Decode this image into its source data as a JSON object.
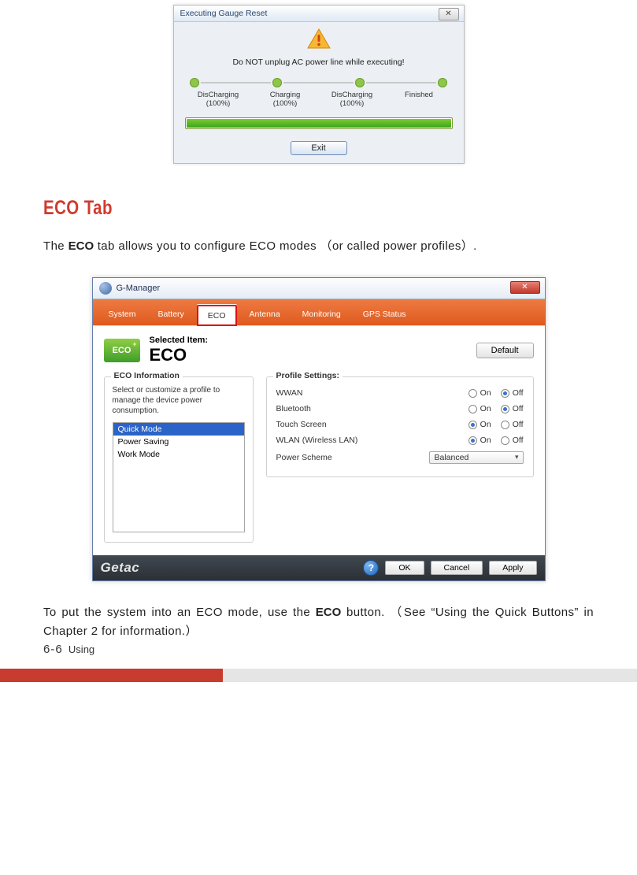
{
  "dlg1": {
    "title": "Executing Gauge Reset",
    "close_glyph": "✕",
    "warning_text": "Do NOT unplug AC power line while executing!",
    "steps": [
      "DisCharging\n(100%)",
      "Charging\n(100%)",
      "DisCharging\n(100%)",
      "Finished"
    ],
    "exit_label": "Exit"
  },
  "doc": {
    "heading": "ECO Tab",
    "para1_before": "The ",
    "para1_bold": "ECO",
    "para1_after": " tab allows you to configure ECO modes （or called power profiles）.",
    "para2_before": "To put the system into an ECO mode, use the ",
    "para2_bold": "ECO",
    "para2_after": " button. （See “Using the Quick Buttons” in Chapter 2 for information.）"
  },
  "dlg2": {
    "title": "G-Manager",
    "tabs": [
      "System",
      "Battery",
      "ECO",
      "Antenna",
      "Monitoring",
      "GPS Status"
    ],
    "active_tab_index": 2,
    "eco_badge": "ECO",
    "selected_item_label": "Selected Item:",
    "selected_item_value": "ECO",
    "default_btn": "Default",
    "eco_info": {
      "title": "ECO Information",
      "desc": "Select or customize a profile to manage the device power consumption.",
      "profiles": [
        "Quick Mode",
        "Power Saving",
        "Work Mode"
      ],
      "selected_index": 0
    },
    "profile_settings": {
      "title": "Profile Settings:",
      "rows": [
        {
          "name": "WWAN",
          "on": "On",
          "off": "Off",
          "checked": "off"
        },
        {
          "name": "Bluetooth",
          "on": "On",
          "off": "Off",
          "checked": "off"
        },
        {
          "name": "Touch Screen",
          "on": "On",
          "off": "Off",
          "checked": "on"
        },
        {
          "name": "WLAN (Wireless LAN)",
          "on": "On",
          "off": "Off",
          "checked": "on"
        }
      ],
      "scheme_label": "Power Scheme",
      "scheme_value": "Balanced"
    },
    "footer": {
      "logo": "Getac",
      "help": "?",
      "ok": "OK",
      "cancel": "Cancel",
      "apply": "Apply"
    }
  },
  "page_footer": {
    "num": "6-6",
    "label": "Using"
  }
}
